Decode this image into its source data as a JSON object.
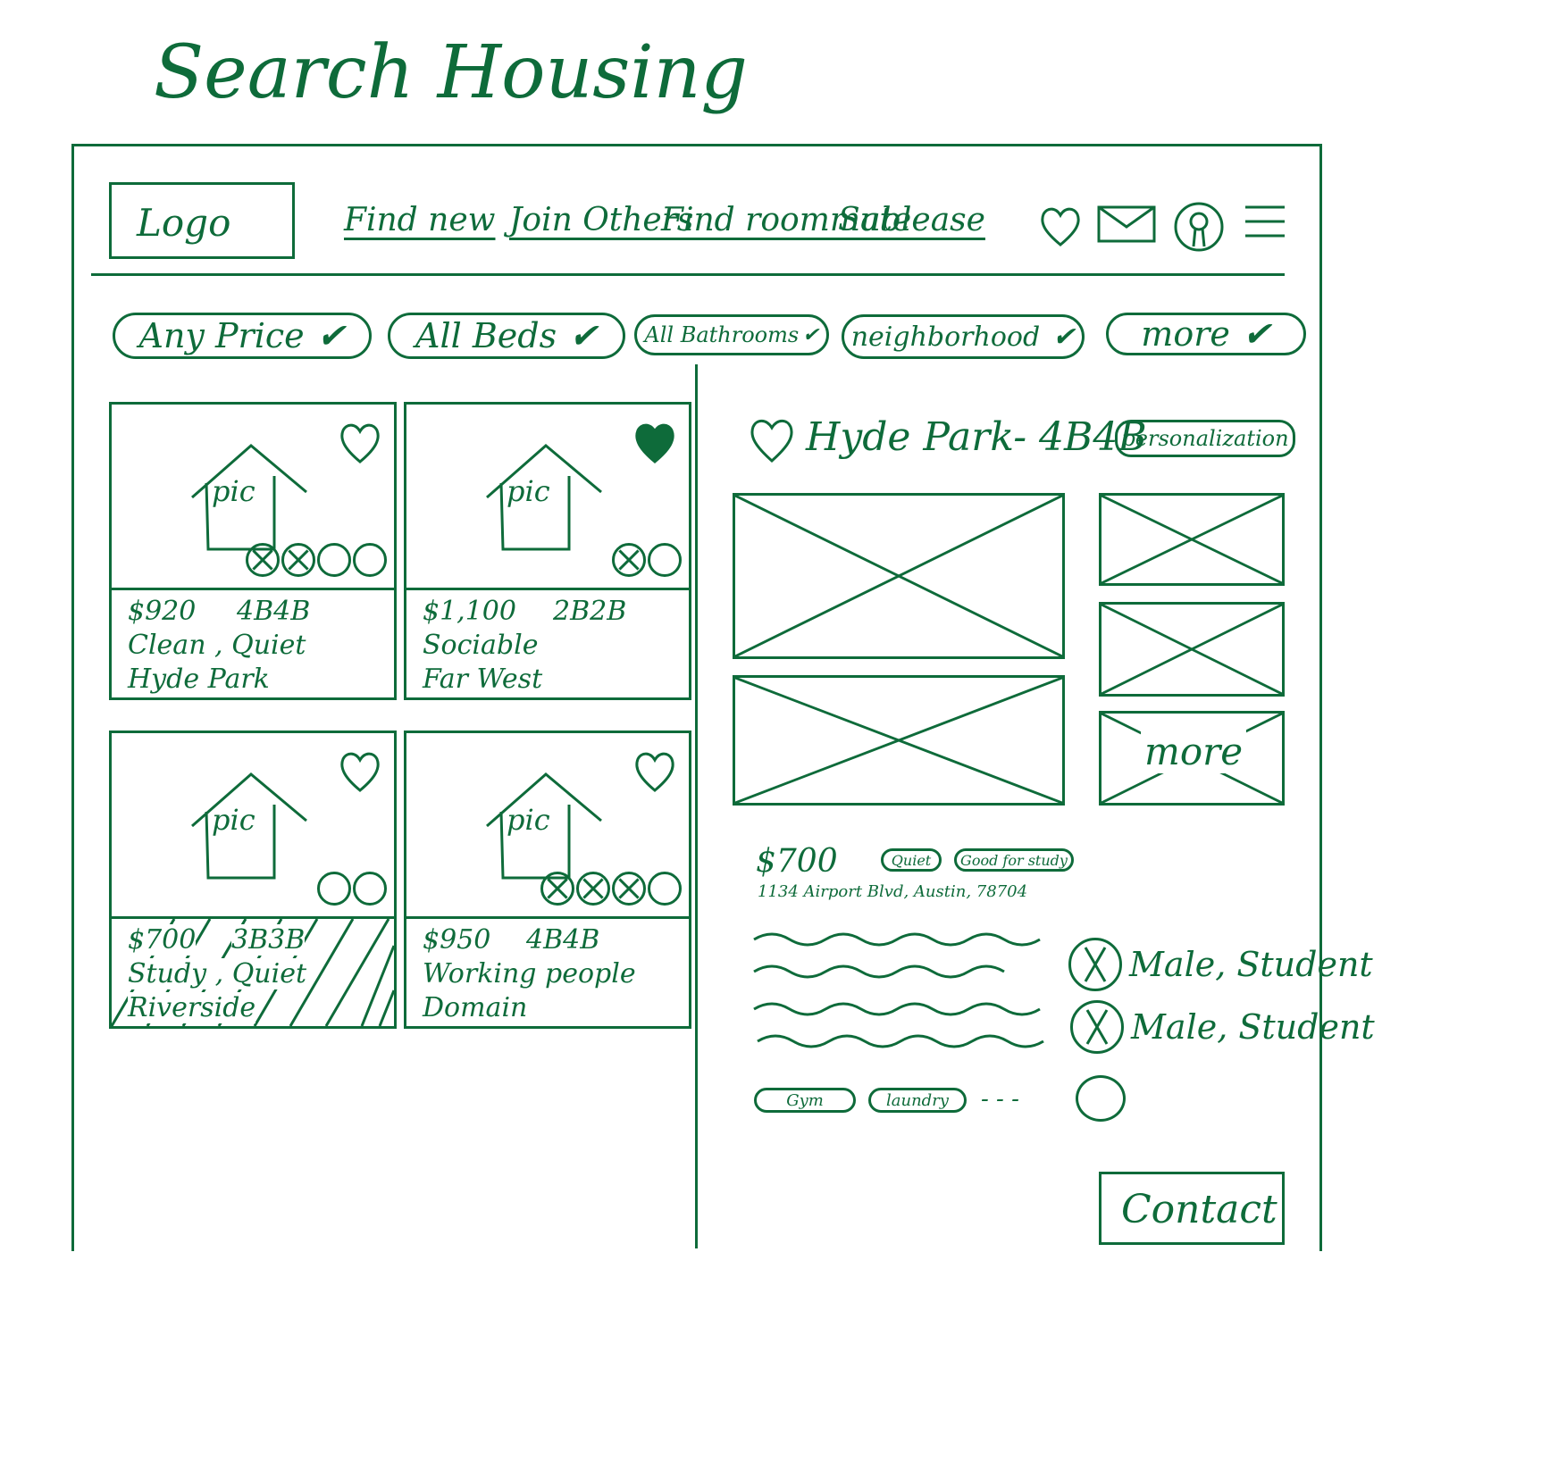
{
  "page": {
    "title": "Search Housing"
  },
  "header": {
    "logo": "Logo",
    "nav": [
      "Find new",
      "Join Others",
      "Find roommate",
      "Sublease"
    ],
    "icons": [
      "heart-icon",
      "mail-icon",
      "profile-icon",
      "menu-icon"
    ]
  },
  "filters": [
    {
      "label": "Any Price"
    },
    {
      "label": "All Beds"
    },
    {
      "label": "All Bathrooms"
    },
    {
      "label": "neighborhood"
    },
    {
      "label": "more"
    }
  ],
  "listings": [
    {
      "price": "$920",
      "beds": "4B4B",
      "tags": "Clean , Quiet",
      "neighborhood": "Hyde Park",
      "pic": "pic",
      "favorited": false,
      "slots_taken": 2,
      "slots_total": 4,
      "selected": false
    },
    {
      "price": "$1,100",
      "beds": "2B2B",
      "tags": "Sociable",
      "neighborhood": "Far West",
      "pic": "pic",
      "favorited": true,
      "slots_taken": 1,
      "slots_total": 2,
      "selected": false
    },
    {
      "price": "$700",
      "beds": "3B3B",
      "tags": "Study , Quiet",
      "neighborhood": "Riverside",
      "pic": "pic",
      "favorited": false,
      "slots_taken": 0,
      "slots_total": 2,
      "selected": true
    },
    {
      "price": "$950",
      "beds": "4B4B",
      "tags": "Working people",
      "neighborhood": "Domain",
      "pic": "pic",
      "favorited": false,
      "slots_taken": 3,
      "slots_total": 4,
      "selected": false
    }
  ],
  "detail": {
    "title": "Hyde Park- 4B4B",
    "personalization": "personalization",
    "more_photos": "more",
    "price": "$700",
    "chips": [
      "Quiet",
      "Good for study"
    ],
    "address": "1134 Airport Blvd, Austin, 78704",
    "roommates": [
      "Male, Student",
      "Male, Student"
    ],
    "amenities": [
      "Gym",
      "laundry"
    ],
    "amenities_more": "- - -",
    "contact": "Contact"
  }
}
